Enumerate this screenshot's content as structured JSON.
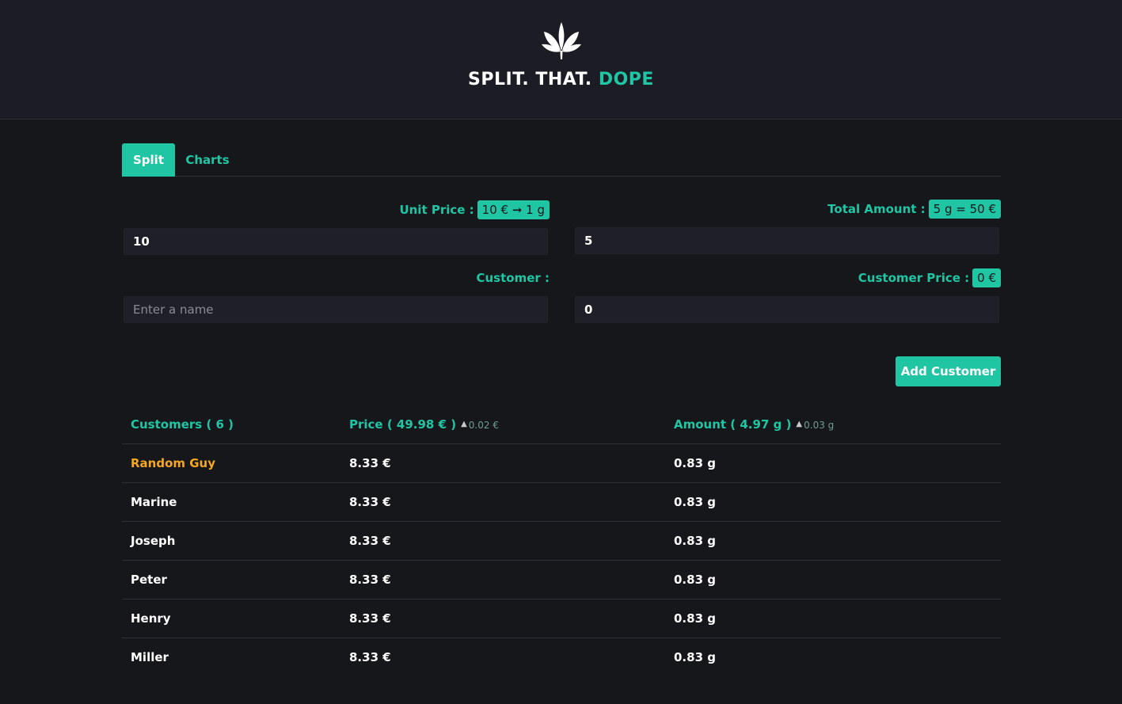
{
  "header": {
    "brand_part1": "SPLIT. THAT.",
    "brand_accent": "DOPE",
    "logo_icon": "cannabis-leaf-icon",
    "accent_color": "#20c5a3"
  },
  "tabs": [
    {
      "label": "Split",
      "active": true
    },
    {
      "label": "Charts",
      "active": false
    }
  ],
  "form": {
    "unit_price": {
      "label": "Unit Price :",
      "badge": "10 € ➞ 1 g",
      "value": "10"
    },
    "total_amount": {
      "label": "Total Amount :",
      "badge": "5 g = 50 €",
      "value": "5"
    },
    "customer": {
      "label": "Customer :",
      "placeholder": "Enter a name",
      "value": ""
    },
    "customer_price": {
      "label": "Customer Price :",
      "badge": "0 €",
      "value": "0"
    },
    "add_button": "Add Customer"
  },
  "table": {
    "headers": {
      "customers": "Customers ( 6 )",
      "price": "Price ( 49.98 € )",
      "price_diff": "0.02 €",
      "amount": "Amount ( 4.97 g )",
      "amount_diff": "0.03 g"
    },
    "rows": [
      {
        "name": "Random Guy",
        "price": "8.33 €",
        "amount": "0.83 g",
        "highlight": true
      },
      {
        "name": "Marine",
        "price": "8.33 €",
        "amount": "0.83 g"
      },
      {
        "name": "Joseph",
        "price": "8.33 €",
        "amount": "0.83 g"
      },
      {
        "name": "Peter",
        "price": "8.33 €",
        "amount": "0.83 g"
      },
      {
        "name": "Henry",
        "price": "8.33 €",
        "amount": "0.83 g"
      },
      {
        "name": "Miller",
        "price": "8.33 €",
        "amount": "0.83 g"
      }
    ]
  }
}
